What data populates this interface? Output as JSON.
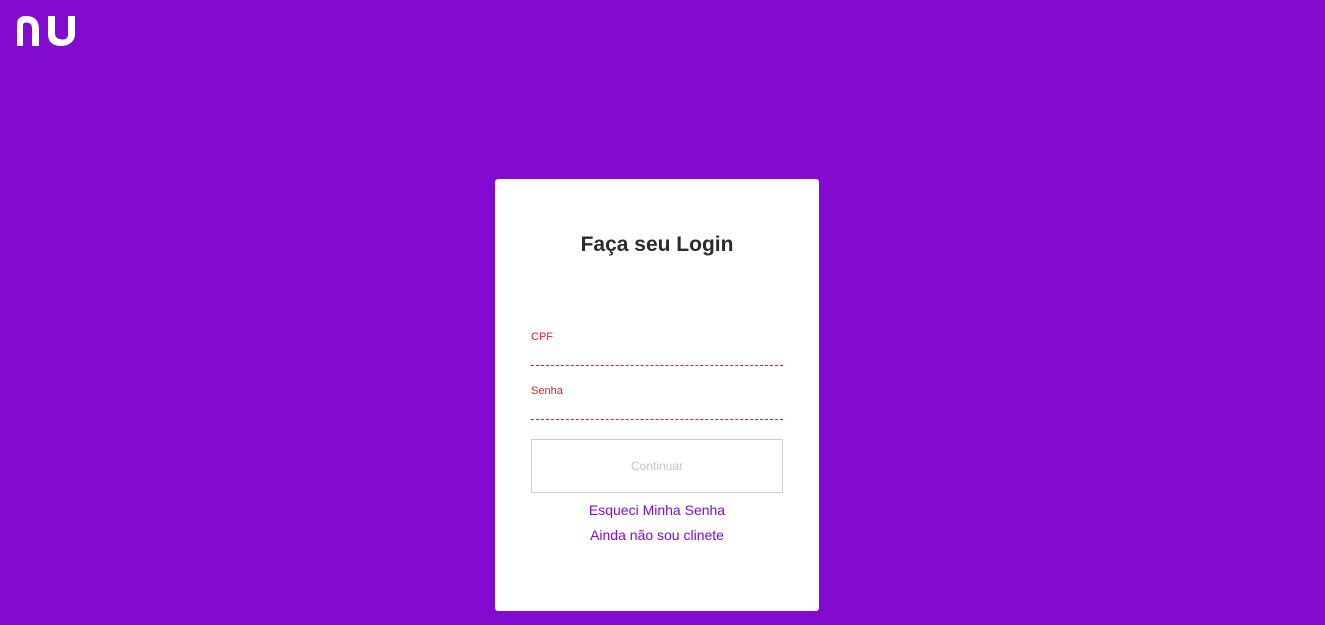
{
  "brand": {
    "logo_text": "nu",
    "background_color": "#820ad1",
    "accent_color": "#820ad1",
    "error_color": "#e02020"
  },
  "login_card": {
    "title": "Faça seu Login",
    "fields": [
      {
        "label": "CPF",
        "value": "",
        "placeholder": ""
      },
      {
        "label": "Senha",
        "value": "",
        "placeholder": ""
      }
    ],
    "continue_label": "Continuar",
    "forgot_password_label": "Esqueci Minha Senha",
    "not_client_label": "Ainda não sou clinete"
  }
}
